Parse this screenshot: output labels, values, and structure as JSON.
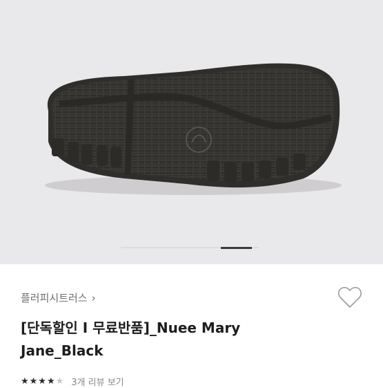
{
  "product": {
    "brand": "플러피시트러스",
    "brand_chevron": "›",
    "title_line1": "[단독할인 I 무료반품]_Nuee Mary",
    "title_line2": "Jane_Black",
    "rating_stars": "★★★★",
    "rating_empty": "★",
    "review_link": "3개 리뷰 보기"
  },
  "gallery": {
    "pager_total": 5,
    "pager_active": 4
  },
  "colors": {
    "gallery_bg": "#e9e8ea",
    "sole": "#3b3a36",
    "sole_dark": "#2a2926",
    "text_primary": "#1d1d1d",
    "text_secondary": "#6f6f6f"
  },
  "icons": {
    "wishlist": "heart-outline-icon",
    "brand_link": "chevron-right-icon"
  }
}
